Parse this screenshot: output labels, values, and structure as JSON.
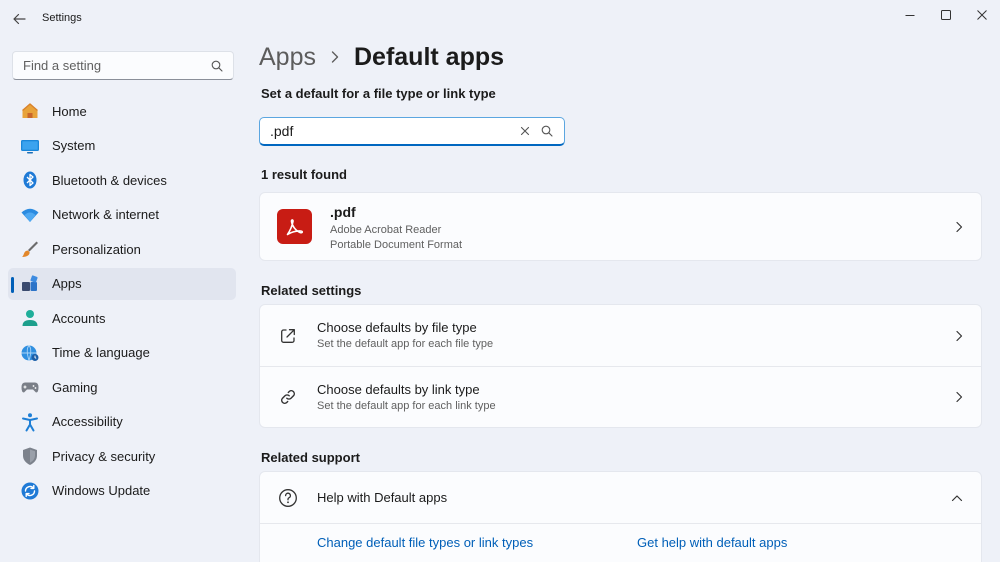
{
  "window": {
    "title": "Settings",
    "search_placeholder": "Find a setting"
  },
  "nav": {
    "items": [
      {
        "label": "Home",
        "icon": "home-icon"
      },
      {
        "label": "System",
        "icon": "system-icon"
      },
      {
        "label": "Bluetooth & devices",
        "icon": "bluetooth-icon"
      },
      {
        "label": "Network & internet",
        "icon": "network-icon"
      },
      {
        "label": "Personalization",
        "icon": "brush-icon"
      },
      {
        "label": "Apps",
        "icon": "apps-icon",
        "selected": true
      },
      {
        "label": "Accounts",
        "icon": "accounts-icon"
      },
      {
        "label": "Time & language",
        "icon": "globe-clock-icon"
      },
      {
        "label": "Gaming",
        "icon": "gamepad-icon"
      },
      {
        "label": "Accessibility",
        "icon": "accessibility-icon"
      },
      {
        "label": "Privacy & security",
        "icon": "shield-icon"
      },
      {
        "label": "Windows Update",
        "icon": "update-icon"
      }
    ]
  },
  "page": {
    "breadcrumb_parent": "Apps",
    "breadcrumb_current": "Default apps",
    "set_default_label": "Set a default for a file type or link type",
    "search_value": ".pdf",
    "results_count": "1 result found"
  },
  "result": {
    "title": ".pdf",
    "app": "Adobe Acrobat Reader",
    "description": "Portable Document Format"
  },
  "related": {
    "heading": "Related settings",
    "items": [
      {
        "title": "Choose defaults by file type",
        "subtitle": "Set the default app for each file type",
        "icon": "open-external-icon"
      },
      {
        "title": "Choose defaults by link type",
        "subtitle": "Set the default app for each link type",
        "icon": "link-icon"
      }
    ]
  },
  "support": {
    "heading": "Related support",
    "title": "Help with Default apps",
    "links": [
      "Change default file types or link types",
      "Get help with default apps"
    ]
  },
  "colors": {
    "accent": "#005fb8",
    "background": "#eef1f8",
    "card": "#fbfcfe",
    "pdf_red": "#c81c14"
  }
}
